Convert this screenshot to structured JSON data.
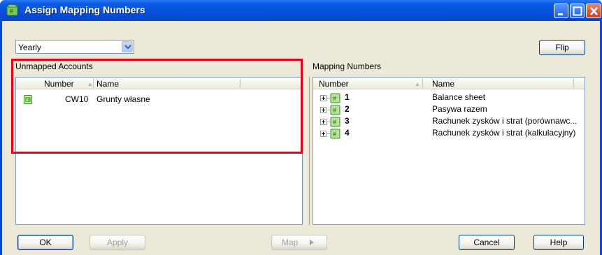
{
  "window": {
    "title": "Assign Mapping Numbers"
  },
  "period": {
    "selected": "Yearly"
  },
  "flip_label": "Flip",
  "unmapped": {
    "label": "Unmapped Accounts",
    "columns": [
      "Number",
      "Name"
    ],
    "rows": [
      {
        "number": "CW10",
        "name": "Grunty własne"
      }
    ]
  },
  "mapping": {
    "label": "Mapping Numbers",
    "columns": [
      "Number",
      "Name"
    ],
    "rows": [
      {
        "number": "1",
        "name": "Balance sheet"
      },
      {
        "number": "2",
        "name": "Pasywa razem"
      },
      {
        "number": "3",
        "name": "Rachunek zysków i strat (porównawc..."
      },
      {
        "number": "4",
        "name": "Rachunek zysków i strat (kalkulacyjny)"
      }
    ]
  },
  "buttons": {
    "ok": "OK",
    "apply": "Apply",
    "map": "Map",
    "cancel": "Cancel",
    "help": "Help"
  },
  "colors": {
    "highlight_box": "#e6001a",
    "titlebar": "#0650d8",
    "dialog_bg": "#ece9d8",
    "icon_green": "#5fbf3a"
  },
  "icons": {
    "title": "mapping-icon",
    "account": "account-icon",
    "map_node": "mapping-number-icon",
    "map_arrow": "play-arrow-icon"
  }
}
